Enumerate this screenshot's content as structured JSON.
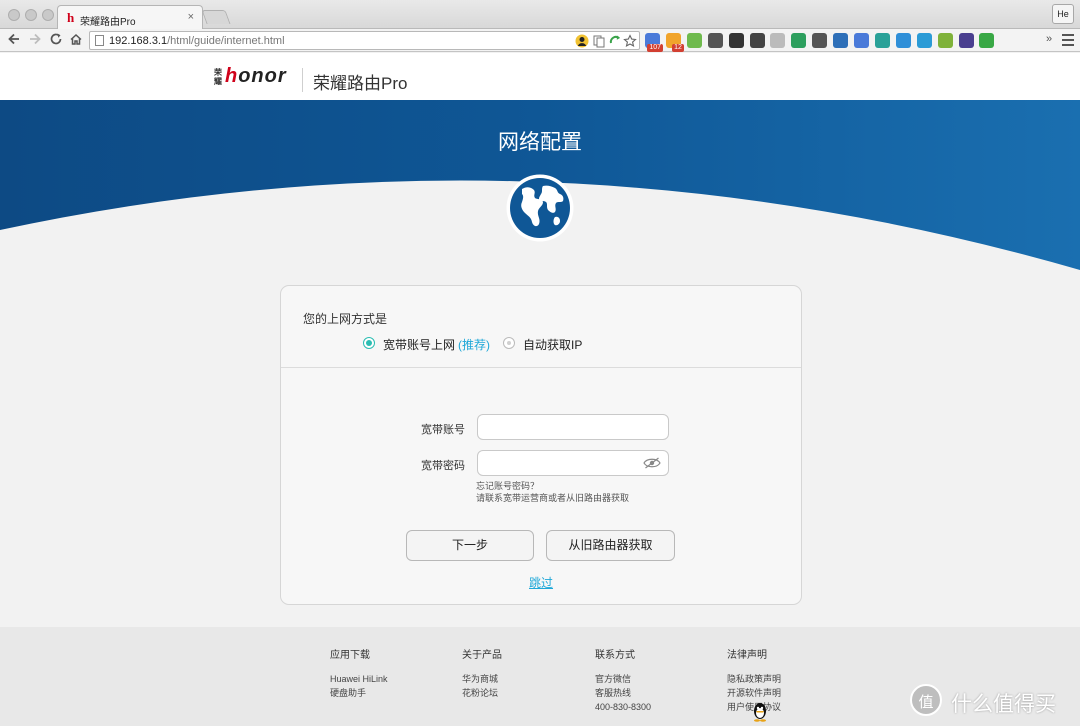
{
  "browser": {
    "tab": {
      "favicon_letter": "h",
      "title": "荣耀路由Pro",
      "close_glyph": "×"
    },
    "profile_label": "He",
    "url_host": "192.168.3.1",
    "url_path": "/html/guide/internet.html",
    "extensions": [
      {
        "icon": "user-silhouette-icon",
        "color": "#222222",
        "badge": ""
      },
      {
        "icon": "page-copy-icon",
        "color": "#8a8a8a",
        "badge": ""
      },
      {
        "icon": "green-arrow-icon",
        "color": "#3aa34a",
        "badge": ""
      },
      {
        "icon": "google-translate-icon",
        "color": "#4a7ad9",
        "badge": "107"
      },
      {
        "icon": "orange-extension-icon",
        "color": "#f1a42b",
        "badge": "12"
      },
      {
        "icon": "green-circle-icon",
        "color": "#6fba4d",
        "badge": ""
      },
      {
        "icon": "pocket-icon",
        "color": "#555555",
        "badge": ""
      },
      {
        "icon": "flame-icon",
        "color": "#333333",
        "badge": ""
      },
      {
        "icon": "clock-icon",
        "color": "#444444",
        "badge": ""
      },
      {
        "icon": "magnifier-icon",
        "color": "#bbbbbb",
        "badge": ""
      },
      {
        "icon": "google-drive-icon",
        "color": "#2d9f5e",
        "badge": ""
      },
      {
        "icon": "settings-gear-icon",
        "color": "#555555",
        "badge": ""
      },
      {
        "icon": "blue-arrow-icon",
        "color": "#2e6fb8",
        "badge": ""
      },
      {
        "icon": "puzzle-icon",
        "color": "#4a7ad9",
        "badge": ""
      },
      {
        "icon": "green-dot-icon",
        "color": "#2aa198",
        "badge": ""
      },
      {
        "icon": "blue-square-icon",
        "color": "#2f8fd8",
        "badge": ""
      },
      {
        "icon": "teal-circle-icon",
        "color": "#2b9bd6",
        "badge": ""
      },
      {
        "icon": "green-face-icon",
        "color": "#7fb23a",
        "badge": ""
      },
      {
        "icon": "shield-icon",
        "color": "#4a3f8f",
        "badge": ""
      },
      {
        "icon": "green-robot-icon",
        "color": "#39a845",
        "badge": ""
      }
    ],
    "overflow_glyph": "»"
  },
  "site": {
    "logo_cn": "荣耀",
    "logo_word_first": "h",
    "logo_word_rest": "onor",
    "product": "荣耀路由Pro"
  },
  "hero": {
    "title": "网络配置"
  },
  "form": {
    "question": "您的上网方式是",
    "options": [
      {
        "label": "宽带账号上网",
        "tag": "(推荐)",
        "selected": true
      },
      {
        "label": "自动获取IP",
        "tag": "",
        "selected": false
      }
    ],
    "account_label": "宽带账号",
    "account_value": "",
    "password_label": "宽带密码",
    "password_value": "",
    "forgot_hint": "忘记账号密码？",
    "forgot_detail": "请联系宽带运营商或者从旧路由器获取",
    "next_button": "下一步",
    "fetch_button": "从旧路由器获取",
    "skip_link": "跳过"
  },
  "footer": {
    "columns": [
      {
        "title": "应用下载",
        "links": [
          "Huawei HiLink",
          "硬盘助手"
        ]
      },
      {
        "title": "关于产品",
        "links": [
          "华为商城",
          "花粉论坛"
        ]
      },
      {
        "title": "联系方式",
        "links": [
          "官方微信",
          "客服热线",
          "400-830-8300"
        ]
      },
      {
        "title": "法律声明",
        "links": [
          "隐私政策声明",
          "开源软件声明",
          "用户使用协议"
        ]
      }
    ]
  },
  "watermark": {
    "text": "什么值得买",
    "glyph": "值"
  },
  "colors": {
    "accent": "#2bbdb2",
    "link": "#1fa8d8",
    "hero_dark": "#0d4a84",
    "hero_light": "#1a6fb0"
  }
}
